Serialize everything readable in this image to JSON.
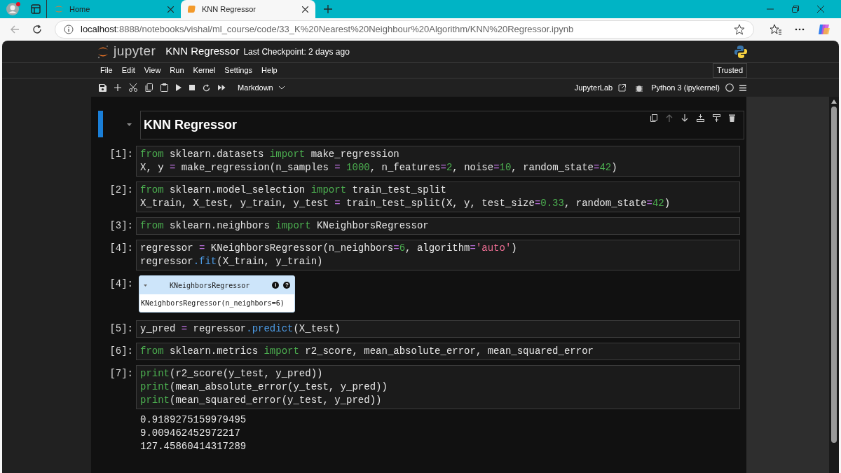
{
  "browser": {
    "tabs": [
      {
        "title": "Home",
        "selected": false
      },
      {
        "title": "KNN Regressor",
        "selected": true
      }
    ],
    "url_host": "localhost",
    "url_rest": ":8888/notebooks/vishal/ml_course/code/33_K%20Nearest%20Neighbour%20Algorithm/KNN%20Regressor.ipynb"
  },
  "header": {
    "logo_text": "jupyter",
    "notebook_title": "KNN Regressor",
    "checkpoint": "Last Checkpoint: 2 days ago"
  },
  "menu": [
    "File",
    "Edit",
    "View",
    "Run",
    "Kernel",
    "Settings",
    "Help"
  ],
  "trusted": "Trusted",
  "toolbar": {
    "cell_type": "Markdown",
    "jupyterlab": "JupyterLab",
    "kernel": "Python 3 (ipykernel)"
  },
  "cells": [
    {
      "kind": "markdown",
      "heading": "KNN Regressor",
      "active": true
    },
    {
      "kind": "code",
      "prompt": "[1]:",
      "lines": [
        [
          {
            "kind": "keyword",
            "t": "from"
          },
          {
            "kind": "plain",
            "t": " sklearn.datasets "
          },
          {
            "kind": "keyword",
            "t": "import"
          },
          {
            "kind": "plain",
            "t": " make_regression"
          }
        ],
        [
          {
            "kind": "plain",
            "t": "X, y "
          },
          {
            "kind": "operator",
            "t": "="
          },
          {
            "kind": "plain",
            "t": " make_regression(n_samples "
          },
          {
            "kind": "operator",
            "t": "="
          },
          {
            "kind": "number",
            "t": " 1000"
          },
          {
            "kind": "plain",
            "t": ", n_features"
          },
          {
            "kind": "operator",
            "t": "="
          },
          {
            "kind": "number",
            "t": "2"
          },
          {
            "kind": "plain",
            "t": ", noise"
          },
          {
            "kind": "operator",
            "t": "="
          },
          {
            "kind": "number",
            "t": "10"
          },
          {
            "kind": "plain",
            "t": ", random_state"
          },
          {
            "kind": "operator",
            "t": "="
          },
          {
            "kind": "number",
            "t": "42"
          },
          {
            "kind": "plain",
            "t": ")"
          }
        ]
      ]
    },
    {
      "kind": "code",
      "prompt": "[2]:",
      "lines": [
        [
          {
            "kind": "keyword",
            "t": "from"
          },
          {
            "kind": "plain",
            "t": " sklearn.model_selection "
          },
          {
            "kind": "keyword",
            "t": "import"
          },
          {
            "kind": "plain",
            "t": " train_test_split"
          }
        ],
        [
          {
            "kind": "plain",
            "t": "X_train, X_test, y_train, y_test "
          },
          {
            "kind": "operator",
            "t": "="
          },
          {
            "kind": "plain",
            "t": " train_test_split(X, y, test_size"
          },
          {
            "kind": "operator",
            "t": "="
          },
          {
            "kind": "number",
            "t": "0.33"
          },
          {
            "kind": "plain",
            "t": ", random_state"
          },
          {
            "kind": "operator",
            "t": "="
          },
          {
            "kind": "number",
            "t": "42"
          },
          {
            "kind": "plain",
            "t": ")"
          }
        ]
      ]
    },
    {
      "kind": "code",
      "prompt": "[3]:",
      "lines": [
        [
          {
            "kind": "keyword",
            "t": "from"
          },
          {
            "kind": "plain",
            "t": " sklearn.neighbors "
          },
          {
            "kind": "keyword",
            "t": "import"
          },
          {
            "kind": "plain",
            "t": " KNeighborsRegressor"
          }
        ]
      ]
    },
    {
      "kind": "code",
      "prompt": "[4]:",
      "lines": [
        [
          {
            "kind": "plain",
            "t": "regressor "
          },
          {
            "kind": "operator",
            "t": "="
          },
          {
            "kind": "plain",
            "t": " KNeighborsRegressor(n_neighbors"
          },
          {
            "kind": "operator",
            "t": "="
          },
          {
            "kind": "number",
            "t": "6"
          },
          {
            "kind": "plain",
            "t": ", algorithm"
          },
          {
            "kind": "operator",
            "t": "="
          },
          {
            "kind": "string",
            "t": "'auto'"
          },
          {
            "kind": "plain",
            "t": ")"
          }
        ],
        [
          {
            "kind": "plain",
            "t": "regressor"
          },
          {
            "kind": "attribute",
            "t": ".fit"
          },
          {
            "kind": "plain",
            "t": "(X_train, y_train)"
          }
        ]
      ]
    },
    {
      "kind": "estimator",
      "prompt": "[4]:",
      "title": "KNeighborsRegressor",
      "info": "i",
      "help": "?",
      "repr": "KNeighborsRegressor(n_neighbors=6)"
    },
    {
      "kind": "code",
      "prompt": "[5]:",
      "lines": [
        [
          {
            "kind": "plain",
            "t": "y_pred "
          },
          {
            "kind": "operator",
            "t": "="
          },
          {
            "kind": "plain",
            "t": " regressor"
          },
          {
            "kind": "attribute",
            "t": ".predict"
          },
          {
            "kind": "plain",
            "t": "(X_test)"
          }
        ]
      ]
    },
    {
      "kind": "code",
      "prompt": "[6]:",
      "lines": [
        [
          {
            "kind": "keyword",
            "t": "from"
          },
          {
            "kind": "plain",
            "t": " sklearn.metrics "
          },
          {
            "kind": "keyword",
            "t": "import"
          },
          {
            "kind": "plain",
            "t": " r2_score, mean_absolute_error, mean_squared_error"
          }
        ]
      ]
    },
    {
      "kind": "code",
      "prompt": "[7]:",
      "lines": [
        [
          {
            "kind": "keyword",
            "t": "print"
          },
          {
            "kind": "plain",
            "t": "(r2_score(y_test, y_pred))"
          }
        ],
        [
          {
            "kind": "keyword",
            "t": "print"
          },
          {
            "kind": "plain",
            "t": "(mean_absolute_error(y_test, y_pred))"
          }
        ],
        [
          {
            "kind": "keyword",
            "t": "print"
          },
          {
            "kind": "plain",
            "t": "(mean_squared_error(y_test, y_pred))"
          }
        ]
      ],
      "output": [
        "0.9189275159979495",
        "9.009462452972217",
        "127.45860414317289"
      ]
    }
  ]
}
